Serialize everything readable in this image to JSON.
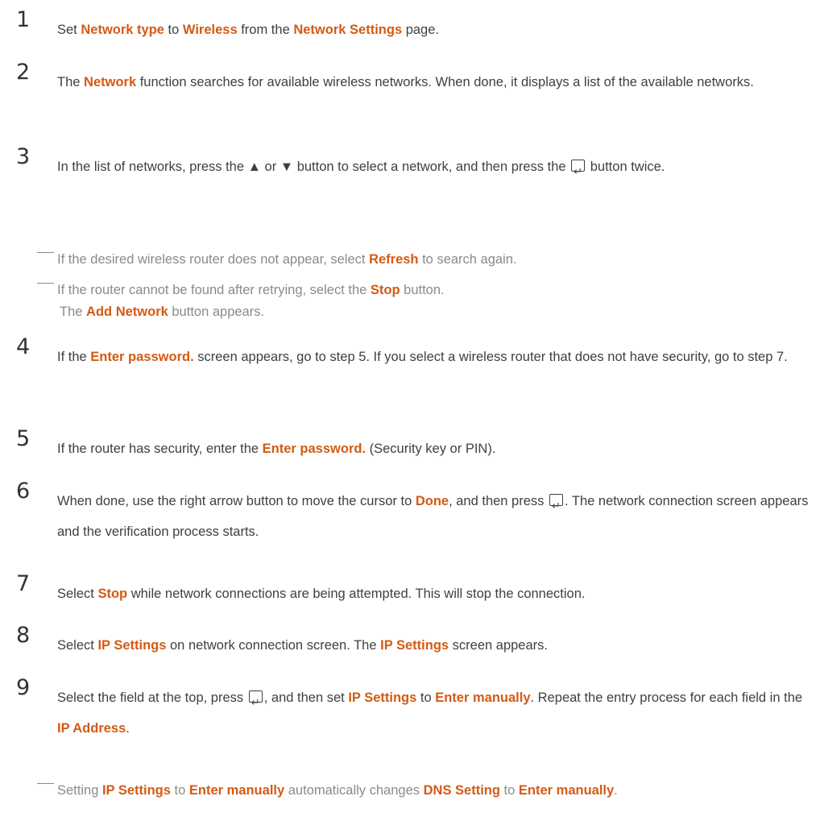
{
  "steps": [
    {
      "num": "1",
      "parts": [
        "Set ",
        {
          "hl": "Network type"
        },
        " to ",
        {
          "hl": "Wireless"
        },
        " from the ",
        {
          "hl": "Network Settings"
        },
        " page."
      ]
    },
    {
      "num": "2",
      "parts": [
        "The ",
        {
          "hl": "Network"
        },
        " function searches for available wireless networks. When done, it displays a list of the available networks."
      ]
    },
    {
      "num": "3",
      "parts": [
        "In the list of networks, press the ▲ or ▼ button to select a network, and then press the ",
        {
          "icon": "enter-icon"
        },
        " button twice."
      ]
    },
    {
      "num": "4",
      "parts": [
        "If the ",
        {
          "hl": "Enter password."
        },
        " screen appears, go to step 5. If you select a wireless router that does not have security, go to step 7."
      ]
    },
    {
      "num": "5",
      "parts": [
        "If the router has security, enter the ",
        {
          "hl": "Enter password."
        },
        " (Security key or PIN)."
      ]
    },
    {
      "num": "6",
      "parts": [
        "When done, use the right arrow button to move the cursor to ",
        {
          "hl": "Done"
        },
        ", and then press ",
        {
          "icon": "enter-icon"
        },
        ". The network connection screen appears and the verification process starts."
      ]
    },
    {
      "num": "7",
      "parts": [
        "Select ",
        {
          "hl": "Stop"
        },
        " while network connections are being attempted. This will stop the connection."
      ]
    },
    {
      "num": "8",
      "parts": [
        "Select ",
        {
          "hl": "IP Settings"
        },
        " on network connection screen. The ",
        {
          "hl": "IP Settings"
        },
        " screen appears."
      ]
    },
    {
      "num": "9",
      "parts": [
        "Select the field at the top, press ",
        {
          "icon": "enter-icon"
        },
        ", and then set ",
        {
          "hl": "IP Settings"
        },
        " to ",
        {
          "hl": "Enter manually"
        },
        ". Repeat the entry process for each field in the ",
        {
          "hl": "IP Address"
        },
        "."
      ]
    }
  ],
  "notes": {
    "after_3_a": [
      "If the desired wireless router does not appear, select ",
      {
        "hl": "Refresh"
      },
      " to search again."
    ],
    "after_3_b": [
      "If the router cannot be found after retrying, select the ",
      {
        "hl": "Stop"
      },
      " button."
    ],
    "after_3_b_cont": [
      "The ",
      {
        "hl": "Add Network"
      },
      " button appears."
    ],
    "after_9": [
      "Setting ",
      {
        "hl": "IP Settings"
      },
      " to ",
      {
        "hl": "Enter manually"
      },
      " automatically changes ",
      {
        "hl": "DNS Setting"
      },
      " to ",
      {
        "hl": "Enter manually"
      },
      "."
    ]
  },
  "colors": {
    "highlight": "#d45a14",
    "text": "#3f3f3f",
    "note": "#8a8a8a"
  }
}
